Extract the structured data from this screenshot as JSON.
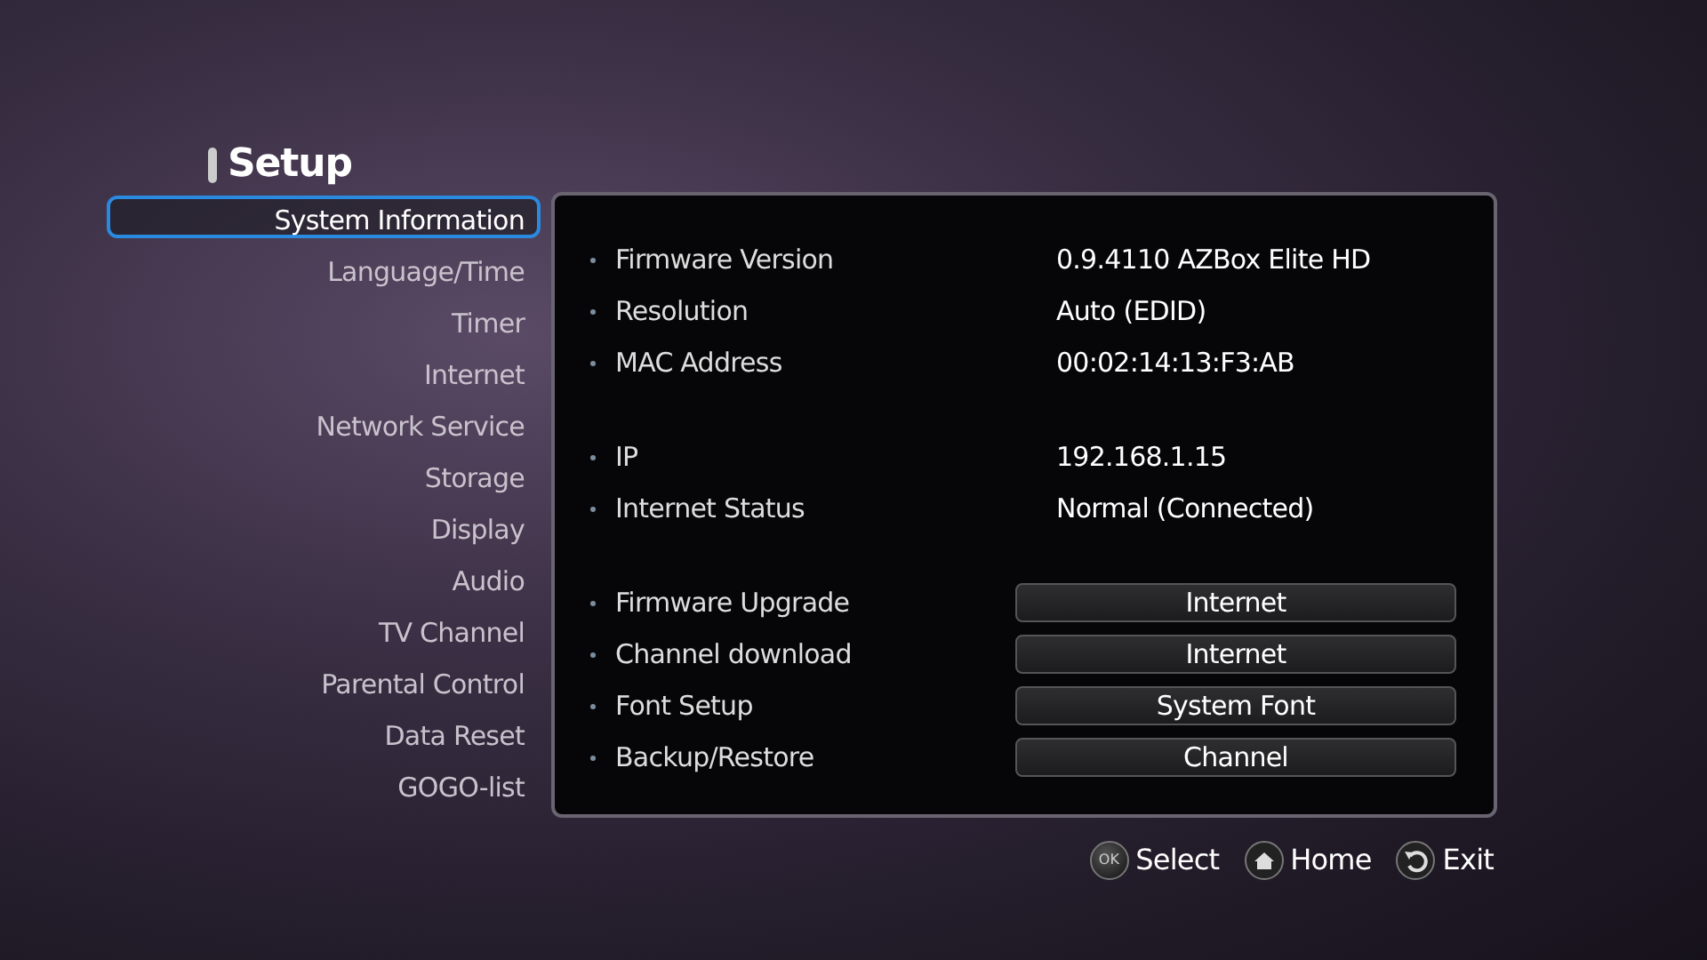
{
  "title": "Setup",
  "menu": [
    {
      "label": "System Information",
      "selected": true
    },
    {
      "label": "Language/Time",
      "selected": false
    },
    {
      "label": "Timer",
      "selected": false
    },
    {
      "label": "Internet",
      "selected": false
    },
    {
      "label": "Network Service",
      "selected": false
    },
    {
      "label": "Storage",
      "selected": false
    },
    {
      "label": "Display",
      "selected": false
    },
    {
      "label": "Audio",
      "selected": false
    },
    {
      "label": "TV Channel",
      "selected": false
    },
    {
      "label": "Parental Control",
      "selected": false
    },
    {
      "label": "Data Reset",
      "selected": false
    },
    {
      "label": "GOGO-list",
      "selected": false
    }
  ],
  "groups": [
    {
      "rows": [
        {
          "kind": "info",
          "label": "Firmware Version",
          "value": "0.9.4110 AZBox Elite HD"
        },
        {
          "kind": "info",
          "label": "Resolution",
          "value": "Auto (EDID)"
        },
        {
          "kind": "info",
          "label": "MAC Address",
          "value": "00:02:14:13:F3:AB"
        }
      ]
    },
    {
      "rows": [
        {
          "kind": "info",
          "label": "IP",
          "value": "192.168.1.15"
        },
        {
          "kind": "info",
          "label": "Internet Status",
          "value": "Normal (Connected)"
        }
      ]
    },
    {
      "rows": [
        {
          "kind": "option",
          "label": "Firmware Upgrade",
          "value": "Internet"
        },
        {
          "kind": "option",
          "label": "Channel download",
          "value": "Internet"
        },
        {
          "kind": "option",
          "label": "Font Setup",
          "value": "System Font"
        },
        {
          "kind": "option",
          "label": "Backup/Restore",
          "value": "Channel"
        }
      ]
    }
  ],
  "hints": [
    {
      "kind": "ok",
      "key": "OK",
      "label": "Select"
    },
    {
      "kind": "home",
      "label": "Home"
    },
    {
      "kind": "back",
      "label": "Exit"
    }
  ]
}
